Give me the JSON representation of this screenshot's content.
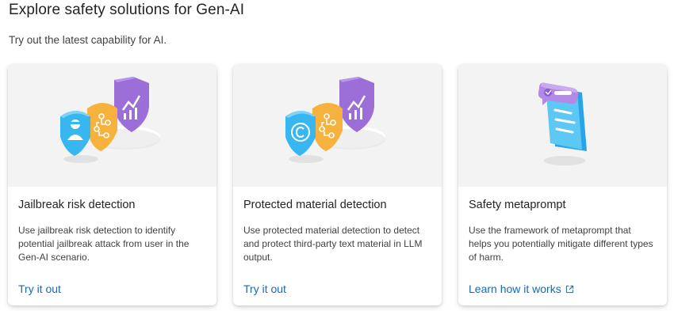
{
  "header": {
    "title": "Explore safety solutions for Gen-AI",
    "subtitle": "Try out the latest capability for AI."
  },
  "cards": [
    {
      "title": "Jailbreak risk detection",
      "description": "Use jailbreak risk detection to identify potential jailbreak attack from user in the Gen-AI scenario.",
      "link": "Try it out",
      "icon": "jailbreak-shields-illustration"
    },
    {
      "title": "Protected material detection",
      "description": "Use protected material detection to detect and protect third-party text material in LLM output.",
      "link": "Try it out",
      "icon": "protected-material-shields-illustration"
    },
    {
      "title": "Safety metaprompt",
      "description": "Use the framework of metaprompt that helps you potentially mitigate different types of harm.",
      "link": "Learn how it works",
      "link_icon": "external-link-icon",
      "icon": "document-chat-illustration"
    }
  ],
  "colors": {
    "link": "#0f6cbd",
    "hero_background": "#f3f3f3",
    "shield_blue": "#38b6ef",
    "shield_orange": "#f6b23c",
    "shield_purple": "#9b6ed8"
  }
}
